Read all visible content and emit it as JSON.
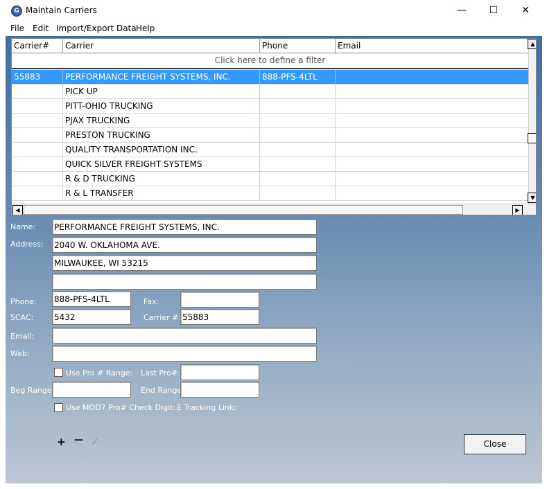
{
  "window": {
    "title": "Maintain Carriers",
    "minimize": "—",
    "maximize": "☐",
    "close": "✕"
  },
  "menu": [
    "File",
    "Edit",
    "Import/Export Data",
    "Help"
  ],
  "grid": {
    "columns": [
      "Carrier#",
      "Carrier",
      "Phone",
      "Email"
    ],
    "filter_text": "Click here to define a filter",
    "rows": [
      {
        "num": "55883",
        "carrier": "PERFORMANCE FREIGHT SYSTEMS, INC.",
        "phone": "888-PFS-4LTL",
        "email": "",
        "selected": true
      },
      {
        "num": "",
        "carrier": "PICK UP",
        "phone": "",
        "email": ""
      },
      {
        "num": "",
        "carrier": "PITT-OHIO TRUCKING",
        "phone": "",
        "email": ""
      },
      {
        "num": "",
        "carrier": "PJAX TRUCKING",
        "phone": "",
        "email": ""
      },
      {
        "num": "",
        "carrier": "PRESTON TRUCKING",
        "phone": "",
        "email": ""
      },
      {
        "num": "",
        "carrier": "QUALITY TRANSPORTATION INC.",
        "phone": "",
        "email": ""
      },
      {
        "num": "",
        "carrier": "QUICK SILVER FREIGHT SYSTEMS",
        "phone": "",
        "email": ""
      },
      {
        "num": "",
        "carrier": "R & D TRUCKING",
        "phone": "",
        "email": ""
      },
      {
        "num": "",
        "carrier": "R & L TRANSFER",
        "phone": "",
        "email": ""
      }
    ]
  },
  "form": {
    "labels": {
      "name": "Name:",
      "address": "Address:",
      "phone": "Phone:",
      "fax": "Fax:",
      "scac": "SCAC:",
      "carrier_num": "Carrier #:",
      "email": "Email:",
      "web": "Web:",
      "use_pro_range": "Use Pro # Range:",
      "last_pro": "Last Pro#:",
      "beg_range": "Beg Range:",
      "end_range": "End Range:",
      "use_mod7": "Use MOD7 Pro# Check Digit:",
      "tracking_link": "E Tracking Link:"
    },
    "values": {
      "name": "PERFORMANCE FREIGHT SYSTEMS, INC.",
      "address1": "2040 W. OKLAHOMA AVE.",
      "address2": "MILWAUKEE, WI 53215",
      "address3": "",
      "phone": "888-PFS-4LTL",
      "fax": "",
      "scac": "5432",
      "carrier_num": "55883",
      "email": "",
      "web": "",
      "last_pro": "",
      "beg_range": "",
      "end_range": ""
    }
  },
  "toolbar": {
    "add": "+",
    "remove": "—",
    "confirm": "✓"
  },
  "close_button": "Close"
}
